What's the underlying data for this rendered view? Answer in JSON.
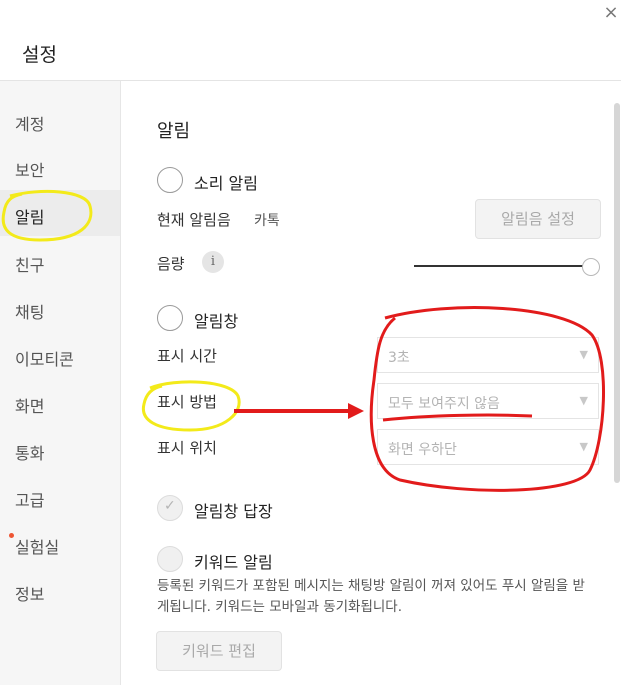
{
  "window": {
    "title": "설정",
    "close_glyph": "×"
  },
  "sidebar": {
    "items": [
      {
        "label": "계정"
      },
      {
        "label": "보안"
      },
      {
        "label": "알림"
      },
      {
        "label": "친구"
      },
      {
        "label": "채팅"
      },
      {
        "label": "이모티콘"
      },
      {
        "label": "화면"
      },
      {
        "label": "통화"
      },
      {
        "label": "고급"
      },
      {
        "label": "실험실"
      },
      {
        "label": "정보"
      }
    ],
    "selected": "알림"
  },
  "content": {
    "heading": "알림",
    "sound_alert": {
      "label": "소리 알림",
      "current_sound_label": "현재 알림음",
      "current_sound_value": "카톡",
      "sound_setting_button": "알림음 설정",
      "volume_label": "음량",
      "info_glyph": "i"
    },
    "popup_alert": {
      "label": "알림창",
      "display_time_label": "표시 시간",
      "display_time_value": "3초",
      "display_method_label": "표시 방법",
      "display_method_value": "모두 보여주지 않음",
      "display_position_label": "표시 위치",
      "display_position_value": "화면 우하단",
      "caret_glyph": "▼"
    },
    "popup_reply": {
      "label": "알림창 답장",
      "check_glyph": "✓"
    },
    "keyword_alert": {
      "label": "키워드 알림",
      "description": "등록된 키워드가 포함된 메시지는 채팅방 알림이 꺼져 있어도 푸시 알림을 받게됩니다. 키워드는 모바일과 동기화됩니다.",
      "edit_button": "키워드 편집"
    }
  },
  "annotation_colors": {
    "highlight": "#f3ea1a",
    "arrow": "#e21b1b"
  }
}
